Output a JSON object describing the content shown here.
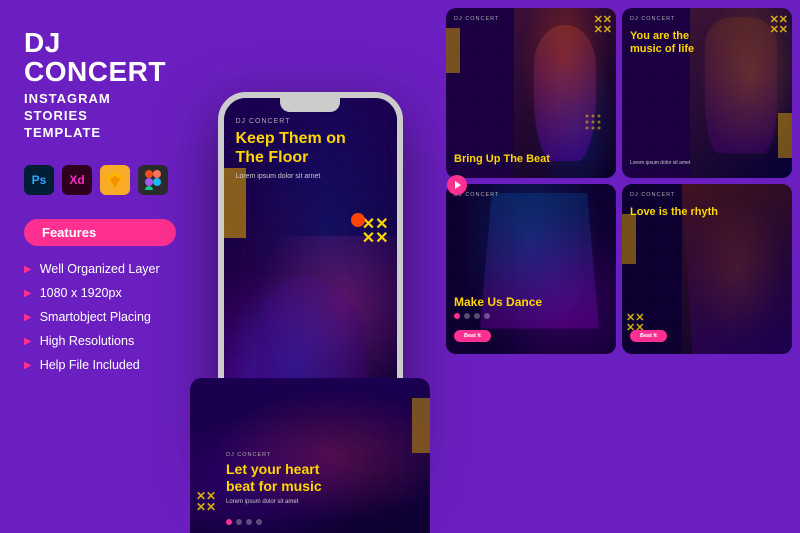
{
  "title": {
    "main": "DJ CONCERT",
    "sub": "INSTAGRAM\nSTORIES\nTEMPLATE"
  },
  "icons": [
    {
      "name": "ps-icon",
      "label": "Ps",
      "bg": "#001E36",
      "color": "#31A8FF"
    },
    {
      "name": "xd-icon",
      "label": "Xd",
      "bg": "#2E001D",
      "color": "#FF2BC2"
    },
    {
      "name": "sketch-icon",
      "label": "S",
      "bg": "#F7AB27",
      "color": "#fff"
    },
    {
      "name": "figma-icon",
      "label": "Fi",
      "bg": "#FF4800",
      "color": "#fff"
    }
  ],
  "features_badge": "Features",
  "features": [
    "Well Organized Layer",
    "1080 x 1920px",
    "Smartobject Placing",
    "High Resolutions",
    "Help File Included"
  ],
  "phone": {
    "label": "DJ CONCERT",
    "heading": "Keep Them on\nThe Floor",
    "subtext": "Lorem ipsum dolor sit arnet"
  },
  "cards": [
    {
      "id": "card-1",
      "label": "DJ CONCERT",
      "title": "Bring Up The Beat",
      "hasButton": false
    },
    {
      "id": "card-2",
      "label": "DJ CONCERT",
      "title": "You are the\nmusic of life",
      "subtext": "Lorem ipsum dolor sit amet",
      "hasButton": false
    },
    {
      "id": "card-3",
      "label": "DJ CONCERT",
      "title": "Make Us Dance",
      "hasButton": true,
      "button": "Beat It"
    },
    {
      "id": "card-4",
      "label": "DJ CONCERT",
      "title": "Love is the rhyth",
      "hasButton": true,
      "button": "Beat It"
    }
  ],
  "bottom_card": {
    "label": "DJ CONCERT",
    "heading": "Let your heart\nbeat for music",
    "subtext": "Lorem ipsum dolor sit amet"
  },
  "colors": {
    "bg": "#6B1FC0",
    "accent_yellow": "#FFD700",
    "accent_pink": "#FF3090",
    "accent_gold": "#B8860B",
    "card_bg": "#1a0040"
  }
}
